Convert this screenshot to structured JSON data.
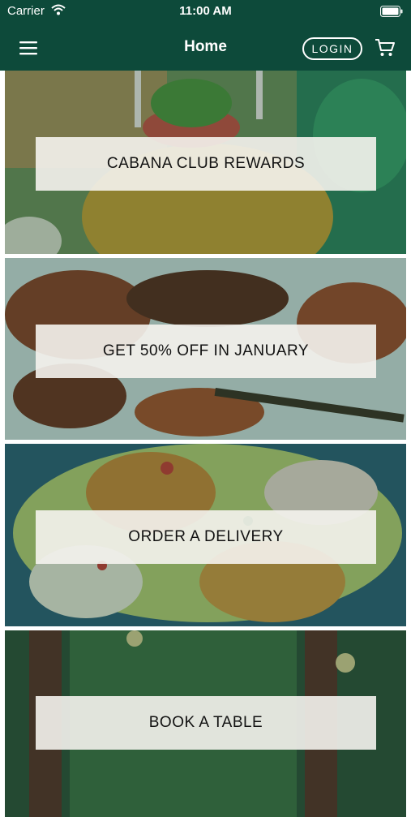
{
  "status_bar": {
    "carrier": "Carrier",
    "time": "11:00 AM"
  },
  "nav": {
    "title": "Home",
    "login_label": "LOGIN"
  },
  "tiles": [
    {
      "label": "CABANA CLUB REWARDS"
    },
    {
      "label": "GET 50% OFF IN JANUARY"
    },
    {
      "label": "ORDER A DELIVERY"
    },
    {
      "label": "BOOK A TABLE"
    }
  ],
  "colors": {
    "brand_green": "#0d4a3a",
    "label_bg": "#f5f3ee"
  }
}
